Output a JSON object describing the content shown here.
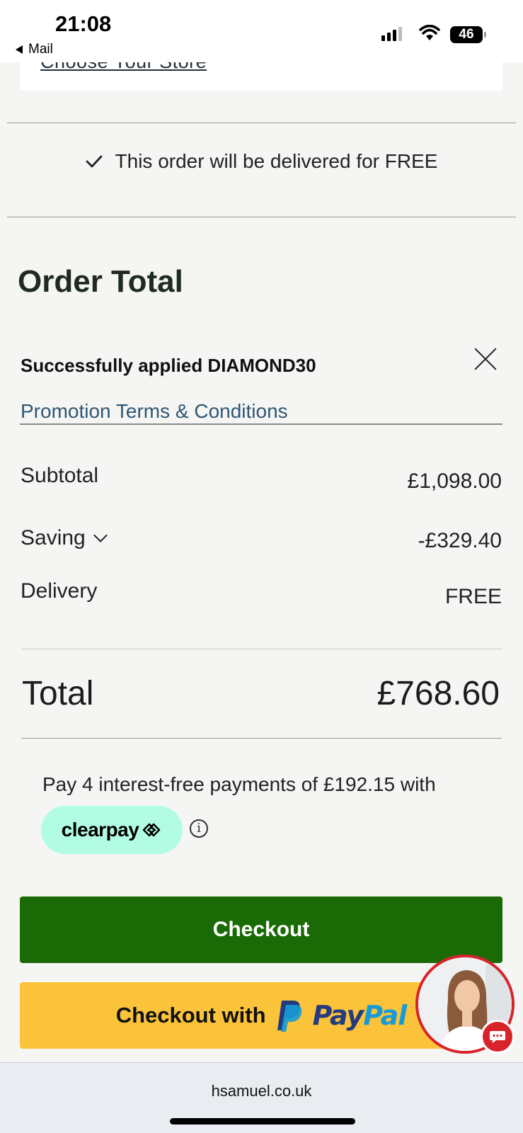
{
  "status_bar": {
    "time": "21:08",
    "back_app": "Mail",
    "battery": "46"
  },
  "store": {
    "choose_store_link": "Choose Your Store"
  },
  "delivery_note": "This order will be delivered for FREE",
  "order_total": {
    "title": "Order Total",
    "promo_message": "Successfully applied DIAMOND30",
    "promo_terms_link": "Promotion Terms & Conditions",
    "rows": [
      {
        "label": "Subtotal",
        "value": "£1,098.00"
      },
      {
        "label": "Saving",
        "value": "-£329.40"
      },
      {
        "label": "Delivery",
        "value": "FREE"
      }
    ],
    "total_label": "Total",
    "total_value": "£768.60"
  },
  "clearpay": {
    "text": "Pay 4 interest-free payments of £192.15 with",
    "brand": "clearpay",
    "info_icon": "info-icon"
  },
  "buttons": {
    "checkout": "Checkout",
    "checkout_with": "Checkout with",
    "paypal_pay": "Pay",
    "paypal_pal": "Pal"
  },
  "browser": {
    "url": "hsamuel.co.uk"
  },
  "colors": {
    "checkout_green": "#1a6b06",
    "paypal_yellow": "#fbc33a",
    "clearpay_mint": "#b2fce4",
    "link_blue": "#2e5874",
    "chat_red": "#d8232a"
  }
}
